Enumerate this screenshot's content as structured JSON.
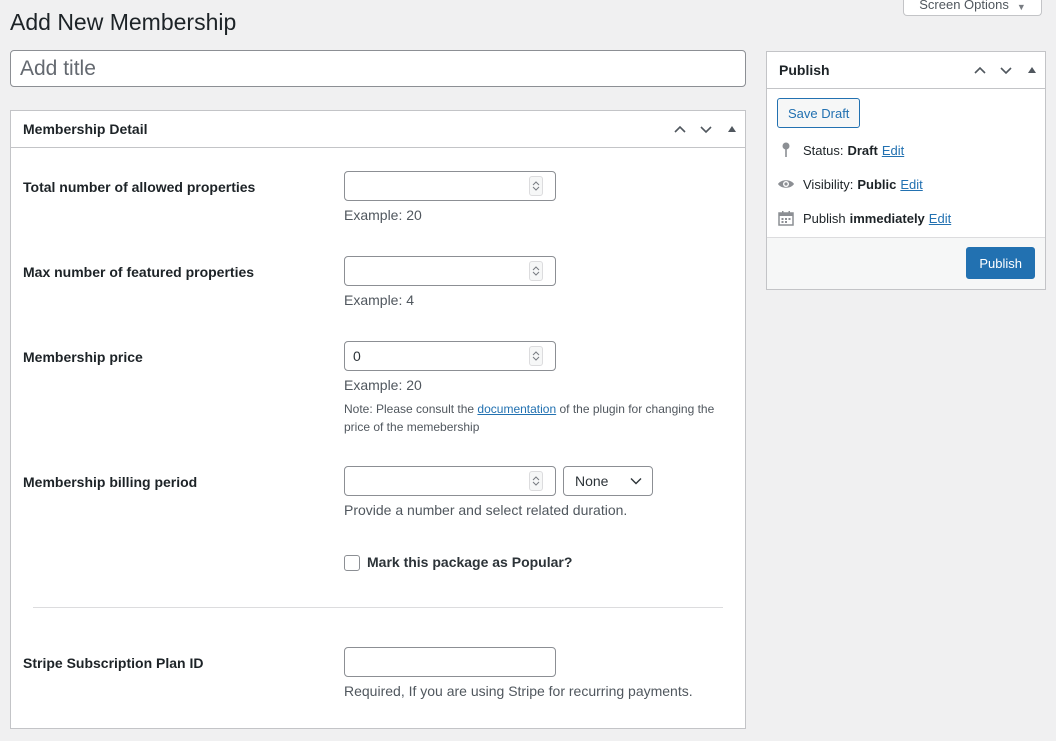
{
  "page": {
    "title": "Add New Membership",
    "screen_options": "Screen Options",
    "title_placeholder": "Add title"
  },
  "membership_box": {
    "heading": "Membership Detail",
    "fields": {
      "allowed": {
        "label": "Total number of allowed properties",
        "value": "",
        "example": "Example: 20"
      },
      "featured": {
        "label": "Max number of featured properties",
        "value": "",
        "example": "Example: 4"
      },
      "price": {
        "label": "Membership price",
        "value": "0",
        "example": "Example: 20",
        "note_before": "Note: Please consult the ",
        "note_link": "documentation",
        "note_after": " of the plugin for changing the price of the memebership"
      },
      "billing": {
        "label": "Membership billing period",
        "value": "",
        "select_value": "None",
        "description": "Provide a number and select related duration."
      },
      "popular": {
        "label": "Mark this package as Popular?",
        "checked": false
      },
      "stripe": {
        "label": "Stripe Subscription Plan ID",
        "value": "",
        "description": "Required, If you are using Stripe for recurring payments."
      }
    }
  },
  "publish_box": {
    "heading": "Publish",
    "save_draft": "Save Draft",
    "status_label": "Status:",
    "status_value": "Draft",
    "visibility_label": "Visibility:",
    "visibility_value": "Public",
    "publish_label": "Publish",
    "publish_value": "immediately",
    "edit": "Edit",
    "publish_button": "Publish"
  },
  "colors": {
    "background": "#f0f0f1",
    "accent": "#2271b1",
    "border": "#c3c4c7"
  },
  "icons": [
    "chevron-up-icon",
    "chevron-down-icon",
    "toggle-arrow-icon",
    "pin-icon",
    "eye-icon",
    "calendar-icon",
    "spinner-arrows-icon"
  ]
}
